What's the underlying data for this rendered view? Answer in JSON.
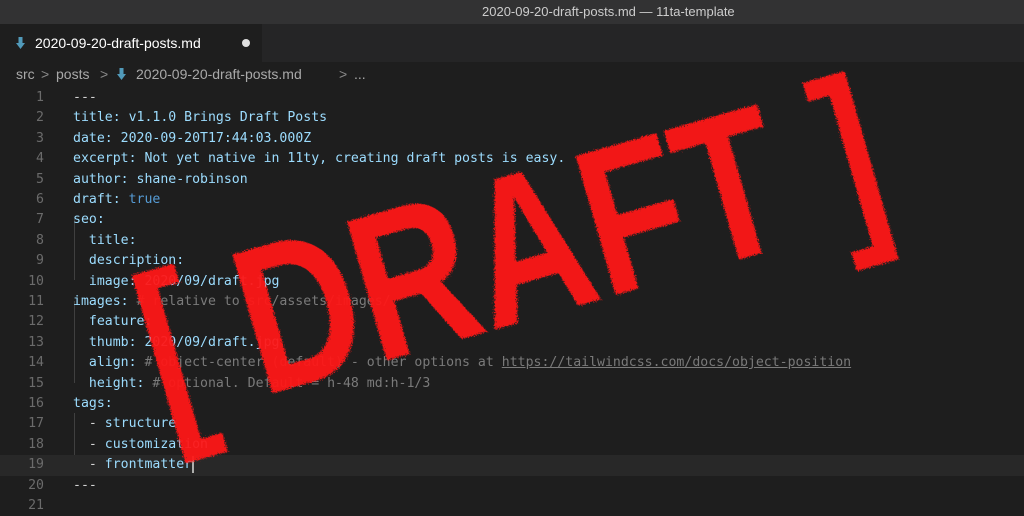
{
  "window": {
    "title": "2020-09-20-draft-posts.md — 11ta-template"
  },
  "tab": {
    "label": "2020-09-20-draft-posts.md",
    "modified": true,
    "icon": "markdown-down-arrow-icon"
  },
  "breadcrumb": {
    "parts": [
      "src",
      "posts",
      "2020-09-20-draft-posts.md",
      "..."
    ],
    "sep": ">"
  },
  "editor": {
    "line_numbers": [
      "1",
      "2",
      "3",
      "4",
      "5",
      "6",
      "7",
      "8",
      "9",
      "10",
      "11",
      "12",
      "13",
      "14",
      "15",
      "16",
      "17",
      "18",
      "19",
      "20",
      "21"
    ],
    "current_line": 19,
    "lines": [
      {
        "key": "---"
      },
      {
        "key": "title:",
        "value": " v1.1.0 Brings Draft Posts"
      },
      {
        "key": "date:",
        "value": " 2020-09-20T17:44:03.000Z"
      },
      {
        "key": "excerpt:",
        "value": " Not yet native in 11ty, creating draft posts is easy."
      },
      {
        "key": "author:",
        "value": " shane-robinson"
      },
      {
        "key": "draft:",
        "value": " true"
      },
      {
        "key": "seo:"
      },
      {
        "indent": "  ",
        "key": "title:"
      },
      {
        "indent": "  ",
        "key": "description:"
      },
      {
        "indent": "  ",
        "key": "image:",
        "value": " 2020/09/draft.jpg"
      },
      {
        "key": "images:",
        "comment": " # relative to src/assets/images/"
      },
      {
        "indent": "  ",
        "key": "feature:"
      },
      {
        "indent": "  ",
        "key": "thumb:",
        "value": " 2020/09/draft.jpg"
      },
      {
        "indent": "  ",
        "key": "align:",
        "comment": " # object-center (default) - other options at ",
        "url": "https://tailwindcss.com/docs/object-position"
      },
      {
        "indent": "  ",
        "key": "height:",
        "comment": " # optional. Default = h-48 md:h-1/3"
      },
      {
        "key": "tags:"
      },
      {
        "indent": "  ",
        "key": "- ",
        "value": "structure"
      },
      {
        "indent": "  ",
        "key": "- ",
        "value": "customization"
      },
      {
        "indent": "  ",
        "key": "- ",
        "value": "frontmatter"
      },
      {
        "key": "---"
      },
      {
        "key": ""
      }
    ]
  },
  "stamp": {
    "text": "[ DRAFT ]",
    "color": "#ff1a1a"
  },
  "colors": {
    "bg": "#1e1e1e",
    "key": "#9cdcfe",
    "comment": "#7a7a7a",
    "stamp": "#ff1a1a"
  }
}
